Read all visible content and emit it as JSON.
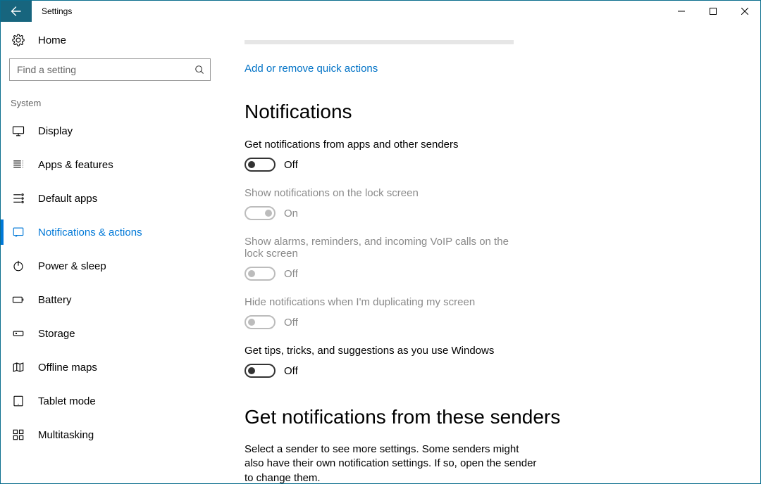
{
  "window": {
    "title": "Settings"
  },
  "sidebar": {
    "home": "Home",
    "search_placeholder": "Find a setting",
    "section": "System",
    "items": [
      {
        "label": "Display",
        "icon": "display"
      },
      {
        "label": "Apps & features",
        "icon": "apps"
      },
      {
        "label": "Default apps",
        "icon": "defaults"
      },
      {
        "label": "Notifications & actions",
        "icon": "notifications",
        "active": true
      },
      {
        "label": "Power & sleep",
        "icon": "power"
      },
      {
        "label": "Battery",
        "icon": "battery"
      },
      {
        "label": "Storage",
        "icon": "storage"
      },
      {
        "label": "Offline maps",
        "icon": "maps"
      },
      {
        "label": "Tablet mode",
        "icon": "tablet"
      },
      {
        "label": "Multitasking",
        "icon": "multitask"
      }
    ]
  },
  "main": {
    "quick_link": "Add or remove quick actions",
    "heading_notifications": "Notifications",
    "settings": [
      {
        "label": "Get notifications from apps and other senders",
        "state": "Off",
        "on": false,
        "disabled": false
      },
      {
        "label": "Show notifications on the lock screen",
        "state": "On",
        "on": true,
        "disabled": true
      },
      {
        "label": "Show alarms, reminders, and incoming VoIP calls on the lock screen",
        "state": "Off",
        "on": false,
        "disabled": true
      },
      {
        "label": "Hide notifications when I'm duplicating my screen",
        "state": "Off",
        "on": false,
        "disabled": true
      },
      {
        "label": "Get tips, tricks, and suggestions as you use Windows",
        "state": "Off",
        "on": false,
        "disabled": false
      }
    ],
    "heading_senders": "Get notifications from these senders",
    "senders_para": "Select a sender to see more settings. Some senders might also have their own notification settings. If so, open the sender to change them."
  }
}
